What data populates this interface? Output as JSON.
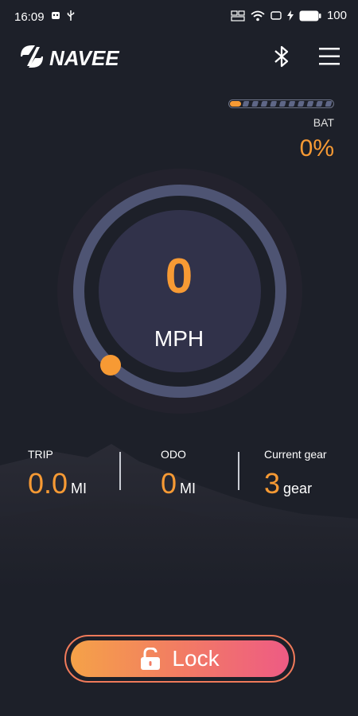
{
  "status_bar": {
    "time": "16:09",
    "battery_text": "100",
    "icons": [
      "notification-icon",
      "usb-icon",
      "nfc-icon",
      "wifi-icon",
      "screen-icon",
      "charging-icon",
      "battery-icon"
    ]
  },
  "header": {
    "brand": "NAVEE",
    "bluetooth_icon": "bluetooth-icon",
    "menu_icon": "menu-icon"
  },
  "battery": {
    "label": "BAT",
    "value": "0%",
    "level_fraction": 0,
    "segments": 11,
    "accent_color": "#f79a34"
  },
  "speed": {
    "value": "0",
    "unit": "MPH",
    "fraction": 0
  },
  "stats": {
    "trip": {
      "label": "TRIP",
      "value": "0.0",
      "unit": "MI"
    },
    "odo": {
      "label": "ODO",
      "value": "0",
      "unit": "MI"
    },
    "gear": {
      "label": "Current gear",
      "value": "3",
      "unit": "gear"
    }
  },
  "lock": {
    "label": "Lock",
    "icon": "unlocked-padlock-icon"
  },
  "colors": {
    "background": "#1d2029",
    "accent": "#f79a34",
    "gauge_track": "#4e5473",
    "gauge_face": "#31324a"
  }
}
